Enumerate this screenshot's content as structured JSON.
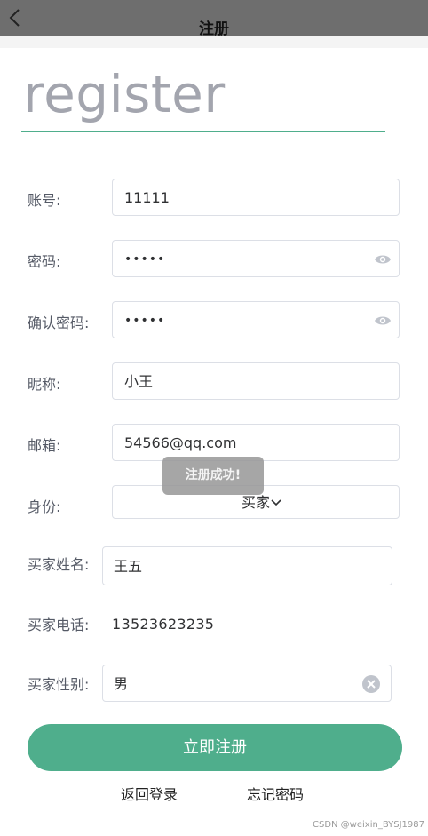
{
  "header": {
    "title": "注册",
    "back_icon": "chevron-left-icon"
  },
  "hero": {
    "text": "register",
    "underline_color": "#4fae8c"
  },
  "form": {
    "account": {
      "label": "账号:",
      "value": "11111"
    },
    "password": {
      "label": "密码:",
      "value": "•••••",
      "icon": "eye-icon"
    },
    "confirm_password": {
      "label": "确认密码:",
      "value": "•••••",
      "icon": "eye-icon"
    },
    "nickname": {
      "label": "昵称:",
      "value": "小王"
    },
    "email": {
      "label": "邮箱:",
      "value": "54566@qq.com"
    },
    "identity": {
      "label": "身份:",
      "value": "买家",
      "icon": "chevron-down-icon"
    },
    "buyer_name": {
      "label": "买家姓名:",
      "value": "王五"
    },
    "buyer_phone": {
      "label": "买家电话:",
      "value": "13523623235"
    },
    "buyer_gender": {
      "label": "买家性别:",
      "value": "男",
      "icon": "clear-icon"
    }
  },
  "toast": {
    "text": "注册成功!"
  },
  "actions": {
    "submit_label": "立即注册",
    "back_login_label": "返回登录",
    "forgot_password_label": "忘记密码"
  },
  "watermark": {
    "text": "CSDN @weixin_BYSJ1987"
  },
  "colors": {
    "accent": "#4fae8c",
    "topbar": "#6e6e6e",
    "hero_text": "#a3a5ae"
  }
}
